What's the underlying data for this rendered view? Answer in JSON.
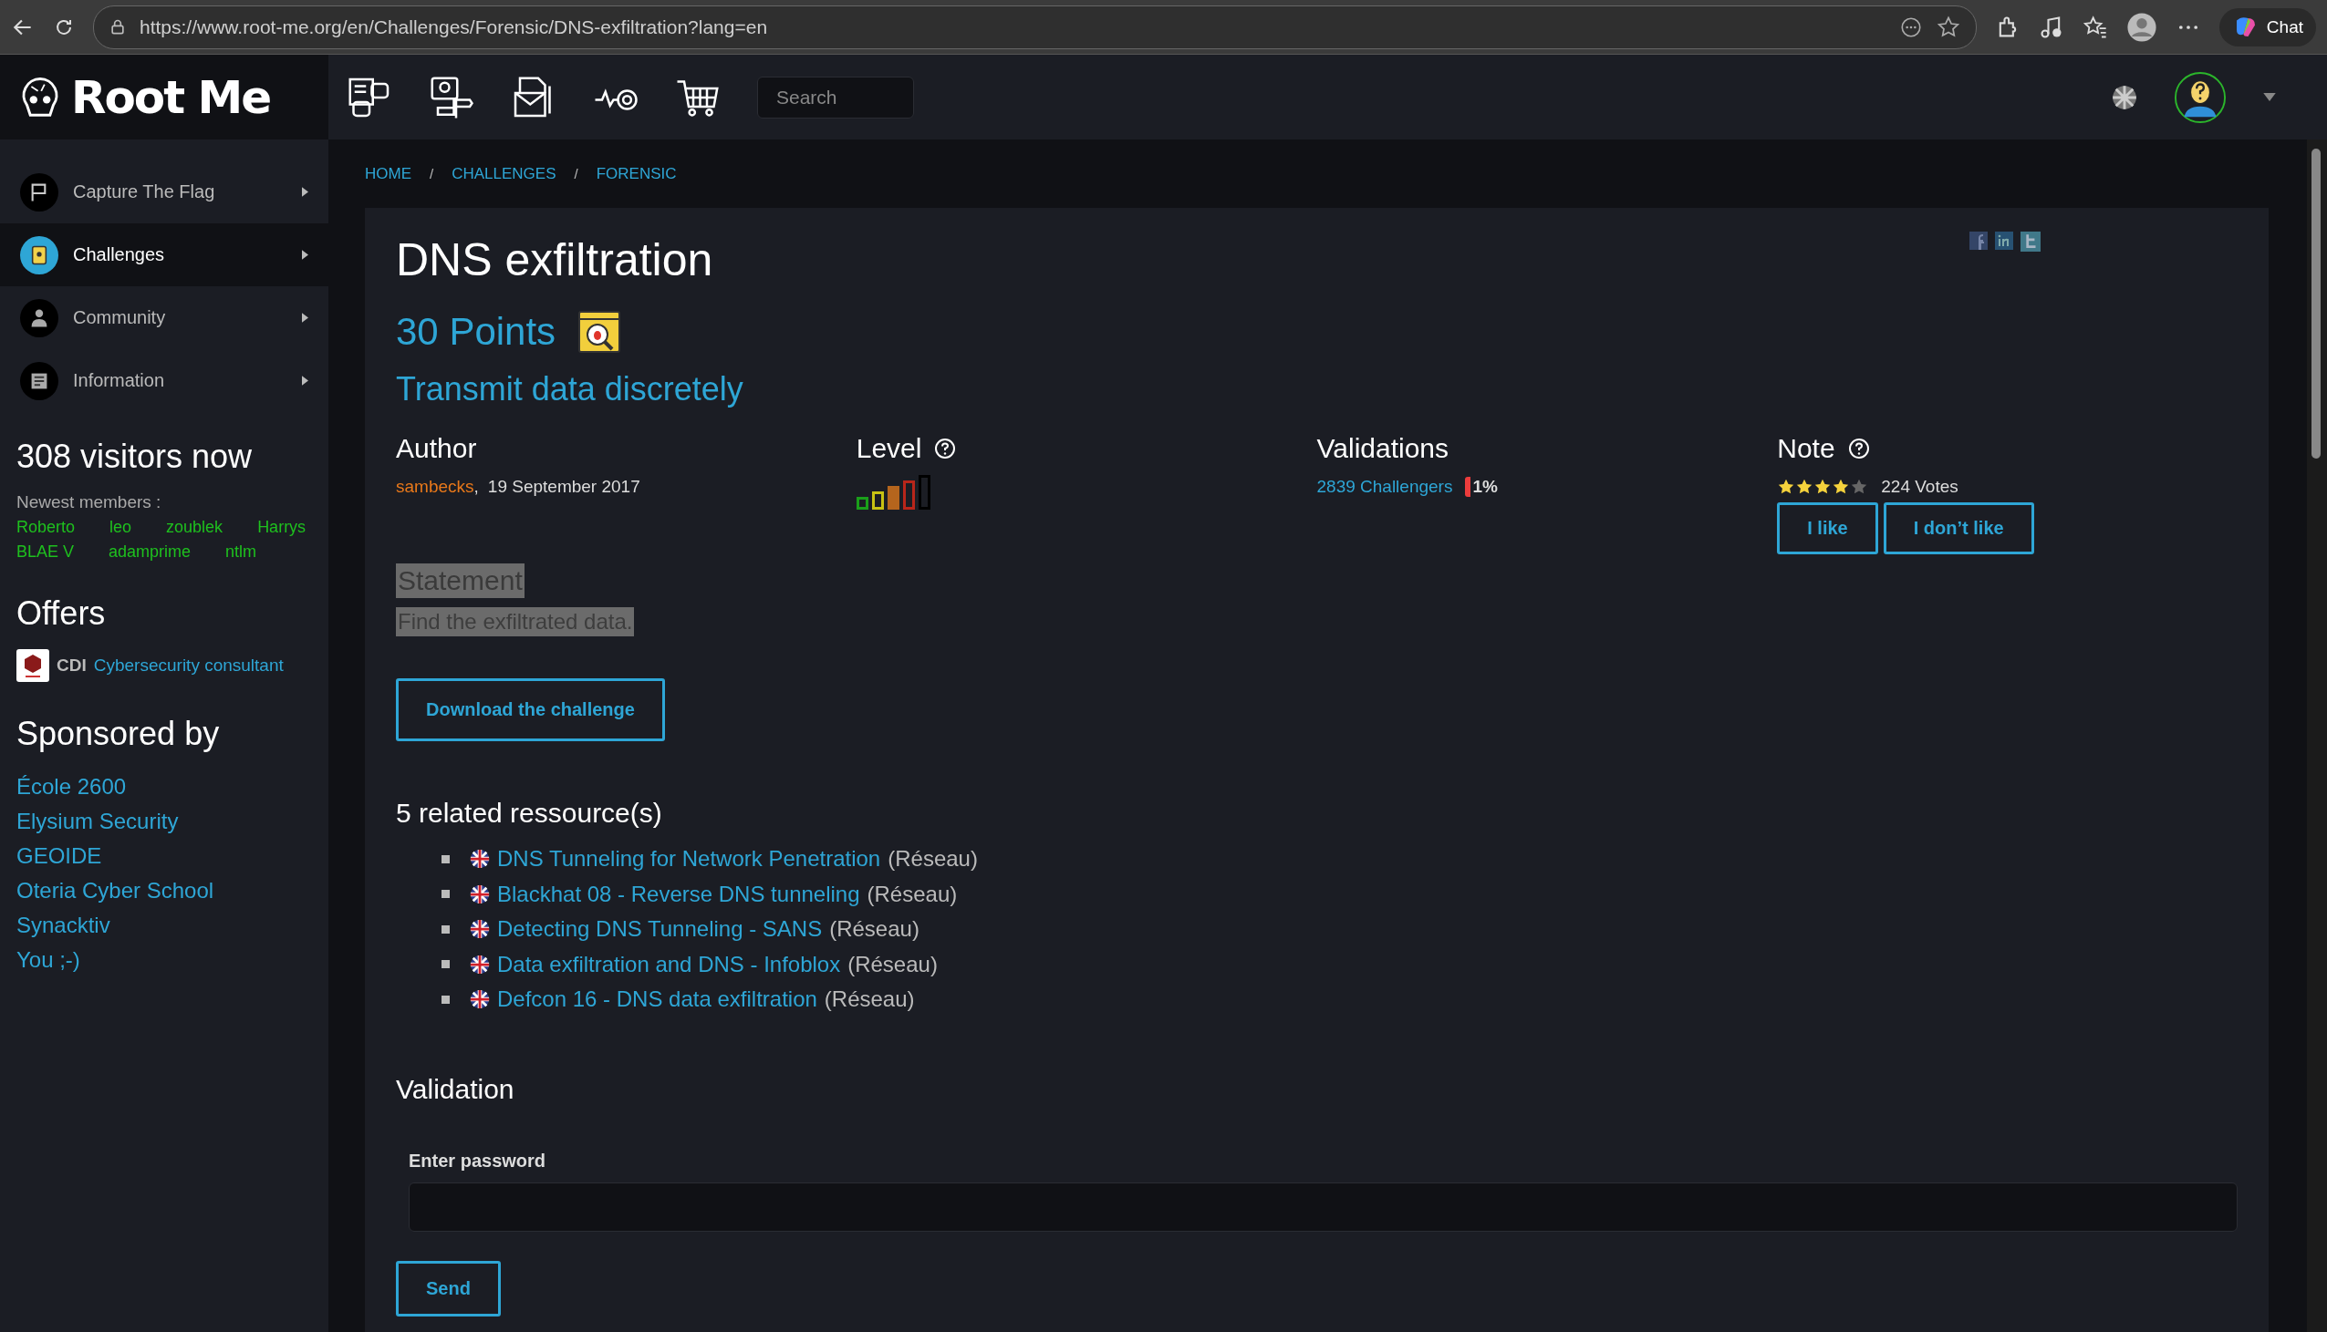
{
  "browser": {
    "url": "https://www.root-me.org/en/Challenges/Forensic/DNS-exfiltration?lang=en",
    "chat_label": "Chat"
  },
  "header": {
    "logo_text": "Root Me",
    "search": {
      "placeholder": "Search"
    }
  },
  "sidebar": {
    "items": [
      {
        "label": "Capture The Flag",
        "selected": false
      },
      {
        "label": "Challenges",
        "selected": true
      },
      {
        "label": "Community",
        "selected": false
      },
      {
        "label": "Information",
        "selected": false
      }
    ],
    "visitors": "308 visitors now",
    "newest_label": "Newest members :",
    "members": [
      "Roberto",
      "leo",
      "zoublek",
      "Harrys",
      "BLAE V",
      "adamprime",
      "ntlm"
    ],
    "offers_title": "Offers",
    "offers": [
      {
        "type": "CDI",
        "title": "Cybersecurity consultant"
      }
    ],
    "sponsors_title": "Sponsored by",
    "sponsors": [
      "École 2600",
      "Elysium Security",
      "GEOIDE",
      "Oteria Cyber School",
      "Synacktiv",
      "You ;-)"
    ]
  },
  "breadcrumb": [
    {
      "kind": "link",
      "text": "HOME"
    },
    {
      "kind": "separator",
      "text": "/"
    },
    {
      "kind": "link",
      "text": "CHALLENGES"
    },
    {
      "kind": "separator",
      "text": "/"
    },
    {
      "kind": "link",
      "text": "FORENSIC"
    }
  ],
  "challenge": {
    "title": "DNS exfiltration",
    "points": "30 Points",
    "subtitle": "Transmit data discretely",
    "author": {
      "heading": "Author",
      "name": "sambecks",
      "separator": ",",
      "date": "19 September 2017"
    },
    "level": {
      "heading": "Level",
      "bars": [
        {
          "color": "#1a9f1a",
          "selected": false
        },
        {
          "color": "#c8c213",
          "selected": false
        },
        {
          "color": "#b5651d",
          "selected": true
        },
        {
          "color": "#b8261a",
          "selected": false
        },
        {
          "color": "#000000",
          "selected": false
        }
      ]
    },
    "validations": {
      "heading": "Validations",
      "count": "2839 Challengers",
      "percent": "1%"
    },
    "note": {
      "heading": "Note",
      "stars": 4,
      "votes": "224 Votes",
      "buttons": [
        "I like",
        "I don’t like"
      ]
    },
    "statement": {
      "heading": "Statement",
      "text": "Find the exfiltrated data."
    },
    "download_button": "Download the challenge",
    "resources": {
      "heading": "5 related ressource(s)",
      "items": [
        {
          "title": "DNS Tunneling for Network Penetration",
          "category": "(Réseau)"
        },
        {
          "title": "Blackhat 08 - Reverse DNS tunneling",
          "category": "(Réseau)"
        },
        {
          "title": "Detecting DNS Tunneling - SANS",
          "category": "(Réseau)"
        },
        {
          "title": "Data exfiltration and DNS - Infoblox",
          "category": "(Réseau)"
        },
        {
          "title": "Defcon 16 - DNS data exfiltration",
          "category": "(Réseau)"
        }
      ]
    },
    "validation": {
      "heading": "Validation",
      "field_label": "Enter password",
      "send_button": "Send"
    }
  }
}
